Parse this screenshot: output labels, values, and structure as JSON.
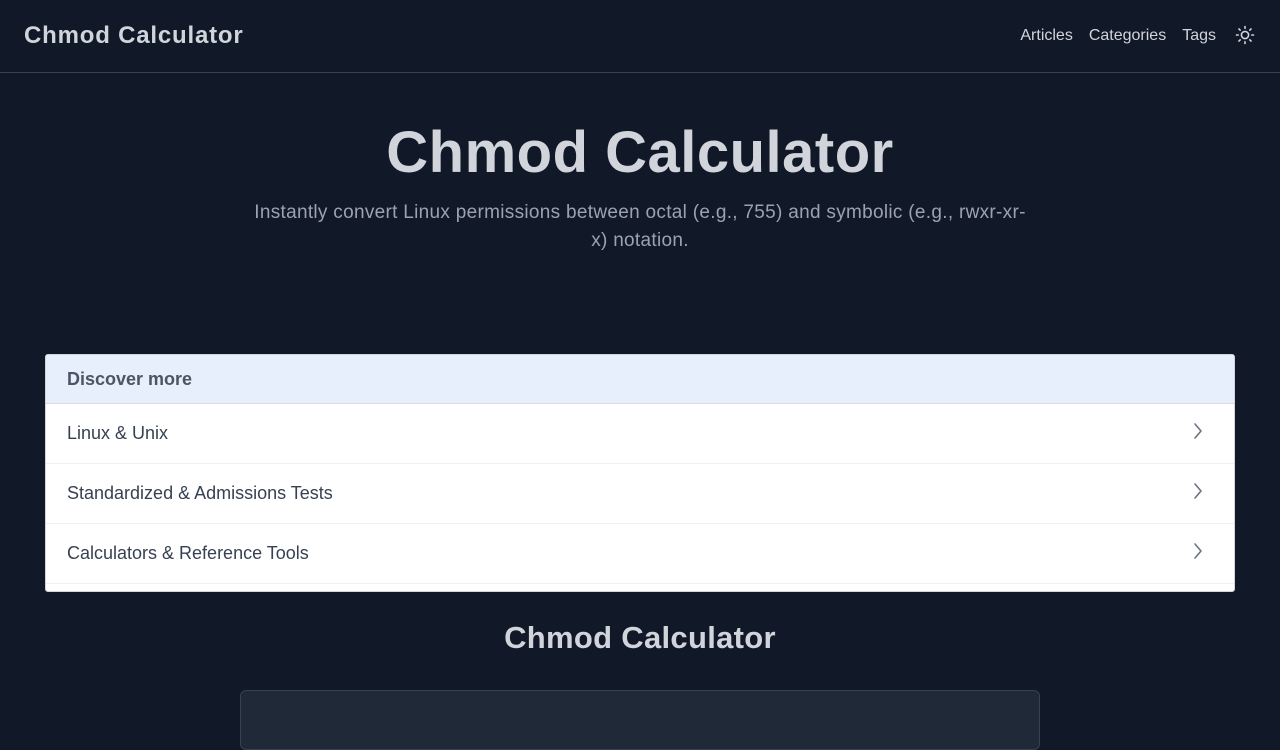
{
  "header": {
    "brand": "Chmod Calculator",
    "nav": [
      {
        "label": "Articles"
      },
      {
        "label": "Categories"
      },
      {
        "label": "Tags"
      }
    ],
    "theme_icon": "sun-icon"
  },
  "hero": {
    "title": "Chmod Calculator",
    "subtitle": "Instantly convert Linux permissions between octal (e.g., 755) and symbolic (e.g., rwxr-xr-x) notation."
  },
  "discover": {
    "heading": "Discover more",
    "items": [
      {
        "label": "Linux & Unix"
      },
      {
        "label": "Standardized & Admissions Tests"
      },
      {
        "label": "Calculators & Reference Tools"
      }
    ],
    "item_icon": "chevron-right-icon"
  },
  "section": {
    "title": "Chmod Calculator"
  },
  "colors": {
    "background": "#111827",
    "text": "#d1d5db",
    "muted": "#9ca3af",
    "card_header": "#e8effc"
  }
}
